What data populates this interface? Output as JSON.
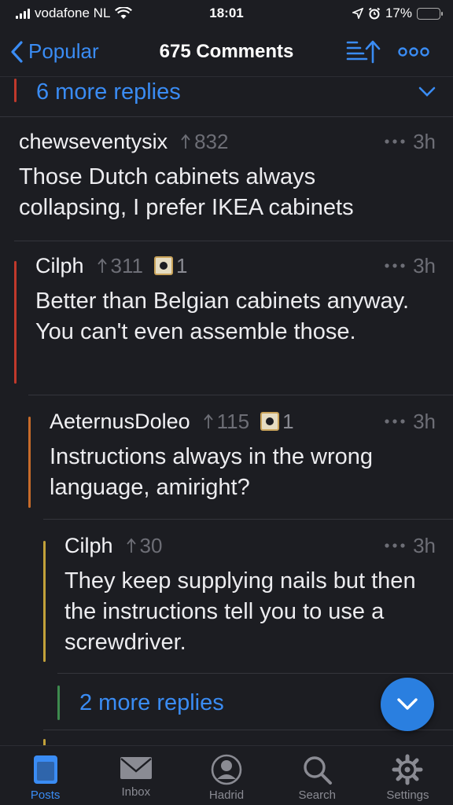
{
  "status_bar": {
    "carrier": "vodafone NL",
    "time": "18:01",
    "battery": "17%",
    "battery_level": 0.17
  },
  "nav": {
    "back_label": "Popular",
    "title": "675 Comments",
    "sort_icon": "sort-ascending-icon",
    "more_icon": "more-horizontal-icon"
  },
  "colors": {
    "accent": "#3a8cf4",
    "depth1": "#c0392b",
    "depth2": "#c0392b",
    "depth3": "#c76b2a",
    "depth4": "#c2a13a",
    "depth5": "#3d8a4e"
  },
  "top_more_replies": "6 more replies",
  "comments": [
    {
      "author": "chewseventysix",
      "votes": "832",
      "time": "3h",
      "body": "Those Dutch cabinets always collapsing, I prefer IKEA cabinets",
      "award_count": ""
    },
    {
      "author": "Cilph",
      "votes": "311",
      "time": "3h",
      "body": "Better than Belgian cabinets anyway. You can't even assemble those.",
      "award_count": "1"
    },
    {
      "author": "AeternusDoleo",
      "votes": "115",
      "time": "3h",
      "body": "Instructions always in the wrong language, amiright?",
      "award_count": "1"
    },
    {
      "author": "Cilph",
      "votes": "30",
      "time": "3h",
      "body": "They keep supplying nails but then the instructions tell you to use a screwdriver.",
      "award_count": ""
    }
  ],
  "bottom_more_replies": "2 more replies",
  "tabs": [
    {
      "label": "Posts",
      "icon": "posts-icon",
      "active": true
    },
    {
      "label": "Inbox",
      "icon": "inbox-icon",
      "active": false
    },
    {
      "label": "Hadrid",
      "icon": "profile-icon",
      "active": false
    },
    {
      "label": "Search",
      "icon": "search-icon",
      "active": false
    },
    {
      "label": "Settings",
      "icon": "gear-icon",
      "active": false
    }
  ]
}
